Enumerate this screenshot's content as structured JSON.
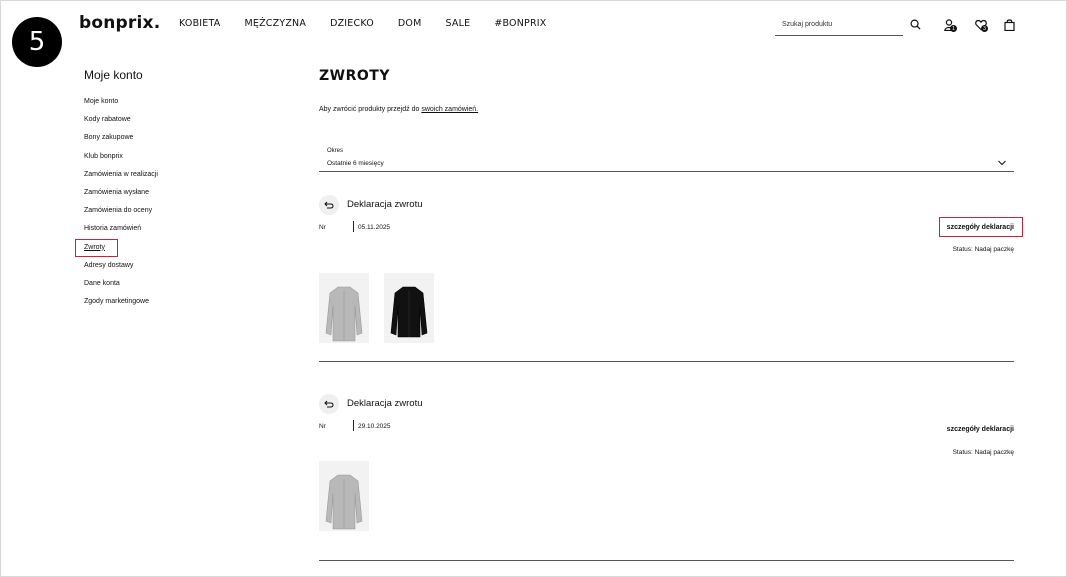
{
  "step": "5",
  "header": {
    "logo": "bonprix.",
    "nav": [
      "KOBIETA",
      "MĘŻCZYZNA",
      "DZIECKO",
      "DOM",
      "SALE",
      "#BONPRIX"
    ],
    "search_placeholder": "Szukaj produktu",
    "user_badge": "1",
    "wishlist_badge": "3"
  },
  "sidebar": {
    "title": "Moje konto",
    "items": [
      {
        "label": "Moje konto"
      },
      {
        "label": "Kody rabatowe"
      },
      {
        "label": "Bony zakupowe"
      },
      {
        "label": "Klub bonprix"
      },
      {
        "label": "Zamówienia w realizacji"
      },
      {
        "label": "Zamówienia wysłane"
      },
      {
        "label": "Zamówienia do oceny"
      },
      {
        "label": "Historia zamówień"
      },
      {
        "label": "Zwroty"
      },
      {
        "label": "Adresy dostawy"
      },
      {
        "label": "Dane konta"
      },
      {
        "label": "Zgody marketingowe"
      }
    ],
    "active_index": 8
  },
  "main": {
    "title": "ZWROTY",
    "intro_text": "Aby zwrócić produkty przejdź do ",
    "intro_link": "swoich zamówień.",
    "period": {
      "label": "Okres",
      "value": "Ostatnie 6 miesięcy"
    },
    "returns": [
      {
        "title": "Deklaracja zwrotu",
        "nr_label": "Nr",
        "date": "05.11.2025",
        "details_label": "szczegóły deklaracji",
        "status": "Status: Nadaj paczkę",
        "items": [
          {
            "name": "grey-coat-thumbnail",
            "color": "#b8b8b8"
          },
          {
            "name": "black-coat-thumbnail",
            "color": "#111111"
          }
        ]
      },
      {
        "title": "Deklaracja zwrotu",
        "nr_label": "Nr",
        "date": "29.10.2025",
        "details_label": "szczegóły deklaracji",
        "status": "Status: Nadaj paczkę",
        "items": [
          {
            "name": "grey-coat-thumbnail",
            "color": "#b8b8b8"
          }
        ]
      }
    ]
  },
  "colors": {
    "highlight": "#d0213a",
    "text": "#111111",
    "thumb_bg": "#f2f2f2"
  }
}
